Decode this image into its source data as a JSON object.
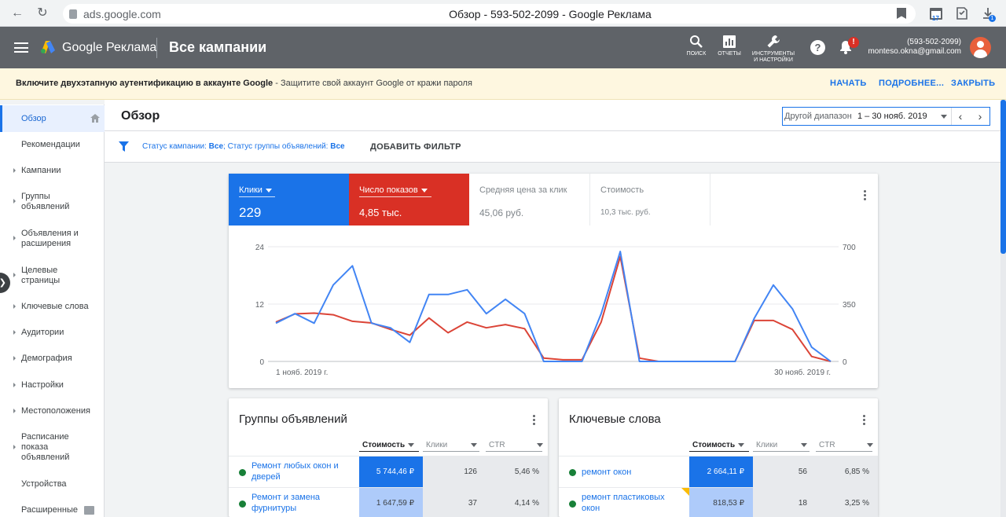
{
  "browser": {
    "url": "ads.google.com",
    "tab_title": "Обзор - 593-502-2099 - Google Реклама",
    "calendar_badge": "17",
    "download_badge": "1"
  },
  "header": {
    "brand": "Google Реклама",
    "section_title": "Все кампании",
    "tools": [
      {
        "label": "поиск",
        "icon": "search-icon"
      },
      {
        "label": "отчеты",
        "icon": "reports-icon"
      },
      {
        "label": "инструменты и настройки",
        "icon": "wrench-icon"
      }
    ],
    "help_label": "?",
    "notification_badge": "!",
    "account_id": "(593-502-2099)",
    "account_email": "monteso.okna@gmail.com"
  },
  "banner": {
    "bold_text": "Включите двухэтапную аутентификацию в аккаунте Google",
    "rest_text": " - Защитите свой аккаунт Google от кражи пароля",
    "actions": [
      "НАЧАТЬ",
      "ПОДРОБНЕЕ...",
      "ЗАКРЫТЬ"
    ]
  },
  "sidebar": {
    "items": [
      {
        "label": "Обзор"
      },
      {
        "label": "Рекомендации"
      },
      {
        "label": "Кампании"
      },
      {
        "label": "Группы объявлений"
      },
      {
        "label": "Объявления и расширения"
      },
      {
        "label": "Целевые страницы"
      },
      {
        "label": "Ключевые слова"
      },
      {
        "label": "Аудитории"
      },
      {
        "label": "Демография"
      },
      {
        "label": "Настройки"
      },
      {
        "label": "Местоположения"
      },
      {
        "label": "Расписание показа объявлений"
      },
      {
        "label": "Устройства"
      },
      {
        "label": "Расширенные"
      }
    ]
  },
  "main": {
    "title": "Обзор",
    "date_range_label": "Другой диапазон",
    "date_range_value": "1 – 30 нояб. 2019",
    "filter": {
      "campaign_status_label": "Статус кампании: ",
      "campaign_status_value": "Все",
      "group_status_label": "; Статус группы объявлений: ",
      "group_status_value": "Все",
      "add_filter": "ДОБАВИТЬ ФИЛЬТР"
    }
  },
  "metrics": [
    {
      "label": "Клики",
      "value": "229",
      "color": "#1a73e8"
    },
    {
      "label": "Число показов",
      "value": "4,85 тыс.",
      "color": "#d93025"
    },
    {
      "label": "Средняя цена за клик",
      "value": "45,06 руб."
    },
    {
      "label": "Стоимость",
      "value": "10,3 тыс. руб."
    }
  ],
  "chart_data": {
    "type": "line",
    "x": [
      1,
      2,
      3,
      4,
      5,
      6,
      7,
      8,
      9,
      10,
      11,
      12,
      13,
      14,
      15,
      16,
      17,
      18,
      19,
      20,
      21,
      22,
      23,
      24,
      25,
      26,
      27,
      28,
      29,
      30
    ],
    "x_start_label": "1 нояб. 2019 г.",
    "x_end_label": "30 нояб. 2019 г.",
    "left_axis": {
      "ticks": [
        "24",
        "12",
        "0"
      ],
      "range": [
        0,
        24
      ]
    },
    "right_axis": {
      "ticks": [
        "700",
        "350",
        "0"
      ],
      "range": [
        0,
        700
      ]
    },
    "grid": true,
    "series": [
      {
        "name": "Клики",
        "axis": "left",
        "color": "#4285f4",
        "values": [
          8,
          10,
          8,
          16,
          20,
          8,
          7,
          4,
          14,
          14,
          15,
          10,
          13,
          10,
          0,
          0,
          0,
          10,
          23,
          0,
          0,
          0,
          0,
          0,
          0,
          9,
          16,
          11,
          3,
          0
        ]
      },
      {
        "name": "Число показов",
        "axis": "right",
        "color": "#db4437",
        "values": [
          240,
          290,
          295,
          285,
          245,
          235,
          195,
          160,
          265,
          175,
          240,
          205,
          225,
          200,
          20,
          10,
          10,
          240,
          640,
          20,
          0,
          0,
          0,
          0,
          0,
          250,
          250,
          195,
          30,
          0
        ]
      }
    ]
  },
  "ad_groups": {
    "title": "Группы объявлений",
    "columns": [
      "Стоимость",
      "Клики",
      "CTR"
    ],
    "rows": [
      {
        "name": "Ремонт любых окон и дверей",
        "cost": "5 744,46 ₽",
        "clicks": "126",
        "ctr": "5,46 %"
      },
      {
        "name": "Ремонт и замена фурнитуры",
        "cost": "1 647,59 ₽",
        "clicks": "37",
        "ctr": "4,14 %"
      }
    ]
  },
  "keywords": {
    "title": "Ключевые слова",
    "columns": [
      "Стоимость",
      "Клики",
      "CTR"
    ],
    "rows": [
      {
        "name": "ремонт окон",
        "cost": "2 664,11 ₽",
        "clicks": "56",
        "ctr": "6,85 %"
      },
      {
        "name": "ремонт пластиковых окон",
        "cost": "818,53 ₽",
        "clicks": "18",
        "ctr": "3,25 %"
      }
    ]
  }
}
